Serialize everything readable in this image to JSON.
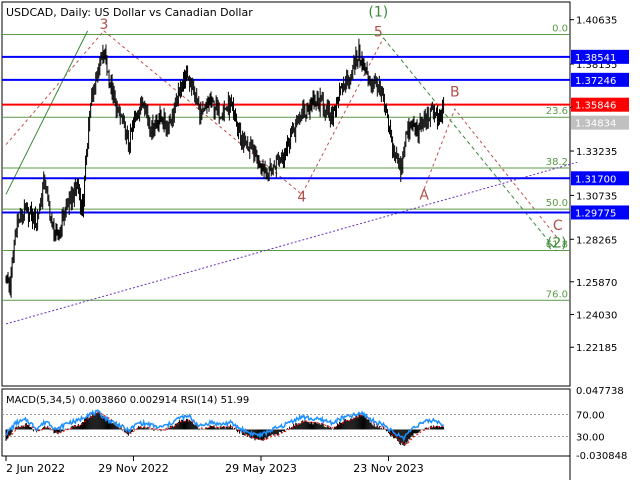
{
  "header": {
    "symbol": "USDCAD",
    "timeframe": "Daily:",
    "description": "US Dollar vs Canadian Dollar"
  },
  "colors": {
    "price": "#000000",
    "blue_level": "#0000ff",
    "red_level": "#ff0000",
    "fib": "#5a9a46",
    "trend_dash": "#6a2fbf",
    "wave_dash_red": "#c0504d",
    "wave_dash_green": "#3a8a3a",
    "wave_label": "#b0504a",
    "wave_label_green": "#3a8a3a",
    "macd_hist": "#000000",
    "macd_signal": "#ff0000",
    "rsi": "#1e90ff"
  },
  "chart_data": [
    {
      "type": "line",
      "panel": "price",
      "title": "USDCAD, Daily:  US Dollar vs Canadian Dollar",
      "ylim": [
        1.2,
        1.4163
      ],
      "price_ticks": [
        "1.40635",
        "1.38135",
        "1.35685",
        "1.33235",
        "1.30735",
        "1.28265",
        "1.25870",
        "1.24030",
        "1.22185"
      ],
      "price_tick_values": [
        1.40635,
        1.38135,
        1.35685,
        1.33235,
        1.30735,
        1.28265,
        1.2587,
        1.2403,
        1.22185
      ],
      "x_labels": [
        "2 Jun 2022",
        "29 Nov 2022",
        "29 May 2023",
        "23 Nov 2023"
      ],
      "x_label_index": [
        0,
        125,
        250,
        375
      ],
      "total_bars": 430,
      "series": [
        {
          "close_anchors": [
            [
              0,
              1.262
            ],
            [
              4,
              1.256
            ],
            [
              10,
              1.291
            ],
            [
              20,
              1.298
            ],
            [
              30,
              1.293
            ],
            [
              38,
              1.316
            ],
            [
              45,
              1.289
            ],
            [
              50,
              1.283
            ],
            [
              58,
              1.299
            ],
            [
              70,
              1.313
            ],
            [
              75,
              1.299
            ],
            [
              82,
              1.355
            ],
            [
              90,
              1.378
            ],
            [
              96,
              1.388
            ],
            [
              102,
              1.37
            ],
            [
              108,
              1.356
            ],
            [
              115,
              1.348
            ],
            [
              120,
              1.335
            ],
            [
              128,
              1.355
            ],
            [
              135,
              1.362
            ],
            [
              142,
              1.345
            ],
            [
              150,
              1.352
            ],
            [
              158,
              1.346
            ],
            [
              165,
              1.355
            ],
            [
              172,
              1.37
            ],
            [
              178,
              1.375
            ],
            [
              185,
              1.364
            ],
            [
              192,
              1.352
            ],
            [
              200,
              1.36
            ],
            [
              210,
              1.354
            ],
            [
              220,
              1.358
            ],
            [
              230,
              1.34
            ],
            [
              240,
              1.333
            ],
            [
              250,
              1.325
            ],
            [
              258,
              1.32
            ],
            [
              265,
              1.326
            ],
            [
              272,
              1.33
            ],
            [
              280,
              1.342
            ],
            [
              290,
              1.353
            ],
            [
              300,
              1.358
            ],
            [
              310,
              1.36
            ],
            [
              318,
              1.35
            ],
            [
              325,
              1.362
            ],
            [
              332,
              1.37
            ],
            [
              340,
              1.378
            ],
            [
              346,
              1.388
            ],
            [
              352,
              1.377
            ],
            [
              358,
              1.371
            ],
            [
              364,
              1.369
            ],
            [
              370,
              1.36
            ],
            [
              376,
              1.343
            ],
            [
              382,
              1.33
            ],
            [
              387,
              1.322
            ],
            [
              392,
              1.342
            ],
            [
              398,
              1.347
            ],
            [
              404,
              1.344
            ],
            [
              410,
              1.349
            ],
            [
              416,
              1.353
            ],
            [
              420,
              1.356
            ],
            [
              424,
              1.35
            ],
            [
              429,
              1.355
            ]
          ]
        }
      ],
      "levels": [
        {
          "value": 1.38541,
          "label": "1.38541",
          "kind": "blue"
        },
        {
          "value": 1.37246,
          "label": "1.37246",
          "kind": "blue"
        },
        {
          "value": 1.35846,
          "label": "1.35846",
          "kind": "red"
        },
        {
          "value": 1.317,
          "label": "1.31700",
          "kind": "blue"
        },
        {
          "value": 1.29775,
          "label": "1.29775",
          "kind": "blue"
        }
      ],
      "current_price": {
        "value": 1.34834,
        "label": "1.34834"
      },
      "fib_levels": [
        {
          "label": "0.0",
          "value": 1.398
        },
        {
          "label": "23.6",
          "value": 1.3514
        },
        {
          "label": "38.2",
          "value": 1.3228
        },
        {
          "label": "50.0",
          "value": 1.2996
        },
        {
          "label": "61.8",
          "value": 1.2763
        },
        {
          "label": "76.0",
          "value": 1.2483
        }
      ],
      "wave_labels": [
        {
          "text": "3",
          "bar": 96,
          "price": 1.401,
          "color": "wave_label"
        },
        {
          "text": "(1)",
          "bar": 365,
          "price": 1.408,
          "color": "wave_label_green"
        },
        {
          "text": "5",
          "bar": 365,
          "price": 1.397,
          "color": "wave_label"
        },
        {
          "text": "4",
          "bar": 290,
          "price": 1.304,
          "color": "wave_label"
        },
        {
          "text": "B",
          "bar": 440,
          "price": 1.363,
          "color": "wave_label"
        },
        {
          "text": "A",
          "bar": 410,
          "price": 1.305,
          "color": "wave_label"
        },
        {
          "text": "C",
          "bar": 541,
          "price": 1.288,
          "color": "wave_label"
        },
        {
          "text": "(2)",
          "bar": 540,
          "price": 1.278,
          "color": "wave_label_green"
        }
      ],
      "wave_paths": [
        {
          "style": "red",
          "points": [
            [
              0,
              1.336
            ],
            [
              96,
              1.4
            ],
            [
              290,
              1.308
            ],
            [
              370,
              1.396
            ]
          ]
        },
        {
          "style": "red",
          "points": [
            [
              410,
              1.311
            ],
            [
              440,
              1.356
            ],
            [
              541,
              1.283
            ]
          ]
        },
        {
          "style": "green",
          "points": [
            [
              370,
              1.396
            ],
            [
              540,
              1.276
            ]
          ]
        },
        {
          "style": "trend",
          "points": [
            [
              0,
              1.235
            ],
            [
              560,
              1.326
            ]
          ]
        },
        {
          "style": "green_solid",
          "points": [
            [
              0,
              1.308
            ],
            [
              80,
              1.4
            ]
          ]
        }
      ]
    },
    {
      "type": "line",
      "panel": "indicator",
      "title": "MACD(5,34,5) 0.003860 0.002914 RSI(14) 51.99",
      "macd_label": "MACD(5,34,5)",
      "macd_value": "0.003860",
      "signal_value": "0.002914",
      "rsi_label": "RSI(14)",
      "rsi_value": "51.99",
      "y_ticks": [
        "0.047738",
        "70.00",
        "30.00",
        "-0.030848"
      ],
      "macd_anchors": [
        [
          0,
          -0.012
        ],
        [
          10,
          0.002
        ],
        [
          20,
          0.006
        ],
        [
          30,
          -0.004
        ],
        [
          40,
          0.004
        ],
        [
          50,
          -0.006
        ],
        [
          60,
          0.002
        ],
        [
          70,
          0.004
        ],
        [
          80,
          0.014
        ],
        [
          90,
          0.022
        ],
        [
          100,
          0.012
        ],
        [
          110,
          0.004
        ],
        [
          120,
          -0.006
        ],
        [
          130,
          0.004
        ],
        [
          140,
          0.002
        ],
        [
          150,
          -0.002
        ],
        [
          160,
          0.002
        ],
        [
          170,
          0.01
        ],
        [
          180,
          0.012
        ],
        [
          190,
          0.0
        ],
        [
          200,
          0.004
        ],
        [
          210,
          0.002
        ],
        [
          220,
          0.004
        ],
        [
          230,
          -0.004
        ],
        [
          240,
          -0.01
        ],
        [
          250,
          -0.014
        ],
        [
          260,
          -0.008
        ],
        [
          270,
          -0.004
        ],
        [
          280,
          0.004
        ],
        [
          290,
          0.01
        ],
        [
          300,
          0.008
        ],
        [
          310,
          0.006
        ],
        [
          320,
          0.002
        ],
        [
          330,
          0.01
        ],
        [
          340,
          0.014
        ],
        [
          350,
          0.018
        ],
        [
          360,
          0.006
        ],
        [
          370,
          0.002
        ],
        [
          380,
          -0.01
        ],
        [
          390,
          -0.02
        ],
        [
          400,
          -0.006
        ],
        [
          410,
          0.0
        ],
        [
          420,
          0.004
        ],
        [
          429,
          0.0039
        ]
      ],
      "rsi_anchors": [
        [
          0,
          35
        ],
        [
          10,
          55
        ],
        [
          20,
          60
        ],
        [
          30,
          45
        ],
        [
          40,
          58
        ],
        [
          50,
          42
        ],
        [
          60,
          55
        ],
        [
          70,
          58
        ],
        [
          80,
          70
        ],
        [
          90,
          74
        ],
        [
          100,
          60
        ],
        [
          110,
          52
        ],
        [
          120,
          40
        ],
        [
          130,
          55
        ],
        [
          140,
          52
        ],
        [
          150,
          46
        ],
        [
          160,
          52
        ],
        [
          170,
          64
        ],
        [
          180,
          66
        ],
        [
          190,
          48
        ],
        [
          200,
          56
        ],
        [
          210,
          52
        ],
        [
          220,
          55
        ],
        [
          230,
          44
        ],
        [
          240,
          36
        ],
        [
          250,
          32
        ],
        [
          260,
          42
        ],
        [
          270,
          48
        ],
        [
          280,
          58
        ],
        [
          290,
          66
        ],
        [
          300,
          62
        ],
        [
          310,
          60
        ],
        [
          320,
          55
        ],
        [
          330,
          64
        ],
        [
          340,
          68
        ],
        [
          350,
          72
        ],
        [
          360,
          58
        ],
        [
          370,
          52
        ],
        [
          380,
          36
        ],
        [
          390,
          28
        ],
        [
          400,
          48
        ],
        [
          410,
          56
        ],
        [
          420,
          60
        ],
        [
          429,
          52
        ]
      ]
    }
  ]
}
